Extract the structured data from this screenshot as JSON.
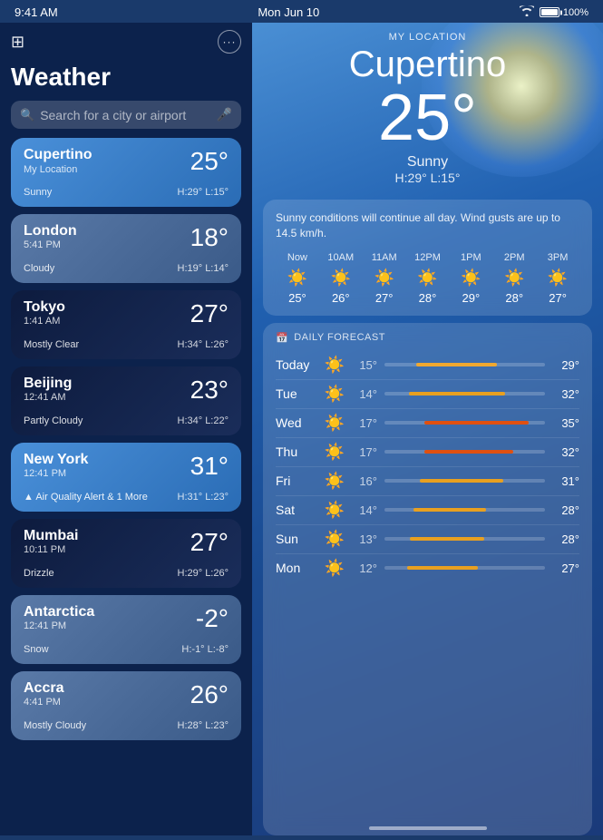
{
  "statusBar": {
    "time": "9:41 AM",
    "date": "Mon Jun 10",
    "wifi": "100%",
    "battery": "100%"
  },
  "leftPanel": {
    "appTitle": "Weather",
    "searchPlaceholder": "Search for a city or airport",
    "moreButton": "...",
    "cities": [
      {
        "name": "Cupertino",
        "sublabel": "My Location",
        "time": "",
        "temp": "25°",
        "condition": "Sunny",
        "hl": "H:29° L:15°",
        "style": "active",
        "alert": ""
      },
      {
        "name": "London",
        "sublabel": "",
        "time": "5:41 PM",
        "temp": "18°",
        "condition": "Cloudy",
        "hl": "H:19° L:14°",
        "style": "gray",
        "alert": ""
      },
      {
        "name": "Tokyo",
        "sublabel": "",
        "time": "1:41 AM",
        "temp": "27°",
        "condition": "Mostly Clear",
        "hl": "H:34° L:26°",
        "style": "night",
        "alert": ""
      },
      {
        "name": "Beijing",
        "sublabel": "",
        "time": "12:41 AM",
        "temp": "23°",
        "condition": "Partly Cloudy",
        "hl": "H:34° L:22°",
        "style": "night",
        "alert": ""
      },
      {
        "name": "New York",
        "sublabel": "",
        "time": "12:41 PM",
        "temp": "31°",
        "condition": "Air Quality Alert & 1 More",
        "hl": "H:31° L:23°",
        "style": "active",
        "alert": "▲"
      },
      {
        "name": "Mumbai",
        "sublabel": "",
        "time": "10:11 PM",
        "temp": "27°",
        "condition": "Drizzle",
        "hl": "H:29° L:26°",
        "style": "night",
        "alert": ""
      },
      {
        "name": "Antarctica",
        "sublabel": "",
        "time": "12:41 PM",
        "temp": "-2°",
        "condition": "Snow",
        "hl": "H:-1° L:-8°",
        "style": "gray",
        "alert": ""
      },
      {
        "name": "Accra",
        "sublabel": "",
        "time": "4:41 PM",
        "temp": "26°",
        "condition": "Mostly Cloudy",
        "hl": "H:28° L:23°",
        "style": "gray",
        "alert": ""
      }
    ]
  },
  "rightPanel": {
    "myLocationLabel": "MY LOCATION",
    "cityName": "Cupertino",
    "temp": "25°",
    "condition": "Sunny",
    "hl": "H:29°  L:15°",
    "description": "Sunny conditions will continue all day. Wind gusts are up to 14.5 km/h.",
    "hourly": [
      {
        "label": "Now",
        "icon": "☀️",
        "temp": "25°"
      },
      {
        "label": "10AM",
        "icon": "☀️",
        "temp": "26°"
      },
      {
        "label": "11AM",
        "icon": "☀️",
        "temp": "27°"
      },
      {
        "label": "12PM",
        "icon": "☀️",
        "temp": "28°"
      },
      {
        "label": "1PM",
        "icon": "☀️",
        "temp": "29°"
      },
      {
        "label": "2PM",
        "icon": "☀️",
        "temp": "28°"
      },
      {
        "label": "3PM",
        "icon": "☀️",
        "temp": "27°"
      }
    ],
    "dailyForecastLabel": "DAILY FORECAST",
    "daily": [
      {
        "day": "Today",
        "icon": "☀️",
        "low": "15°",
        "high": "29°",
        "barLeft": "20%",
        "barWidth": "50%",
        "barColor": "#f0a830"
      },
      {
        "day": "Tue",
        "icon": "☀️",
        "low": "14°",
        "high": "32°",
        "barLeft": "15%",
        "barWidth": "60%",
        "barColor": "#e8a020"
      },
      {
        "day": "Wed",
        "icon": "☀️",
        "low": "17°",
        "high": "35°",
        "barLeft": "25%",
        "barWidth": "65%",
        "barColor": "#e05010"
      },
      {
        "day": "Thu",
        "icon": "☀️",
        "low": "17°",
        "high": "32°",
        "barLeft": "25%",
        "barWidth": "55%",
        "barColor": "#e05010"
      },
      {
        "day": "Fri",
        "icon": "☀️",
        "low": "16°",
        "high": "31°",
        "barLeft": "22%",
        "barWidth": "52%",
        "barColor": "#e8a020"
      },
      {
        "day": "Sat",
        "icon": "☀️",
        "low": "14°",
        "high": "28°",
        "barLeft": "18%",
        "barWidth": "45%",
        "barColor": "#e8a020"
      },
      {
        "day": "Sun",
        "icon": "☀️",
        "low": "13°",
        "high": "28°",
        "barLeft": "16%",
        "barWidth": "46%",
        "barColor": "#e8a020"
      },
      {
        "day": "Mon",
        "icon": "☀️",
        "low": "12°",
        "high": "27°",
        "barLeft": "14%",
        "barWidth": "44%",
        "barColor": "#e8a020"
      }
    ]
  }
}
